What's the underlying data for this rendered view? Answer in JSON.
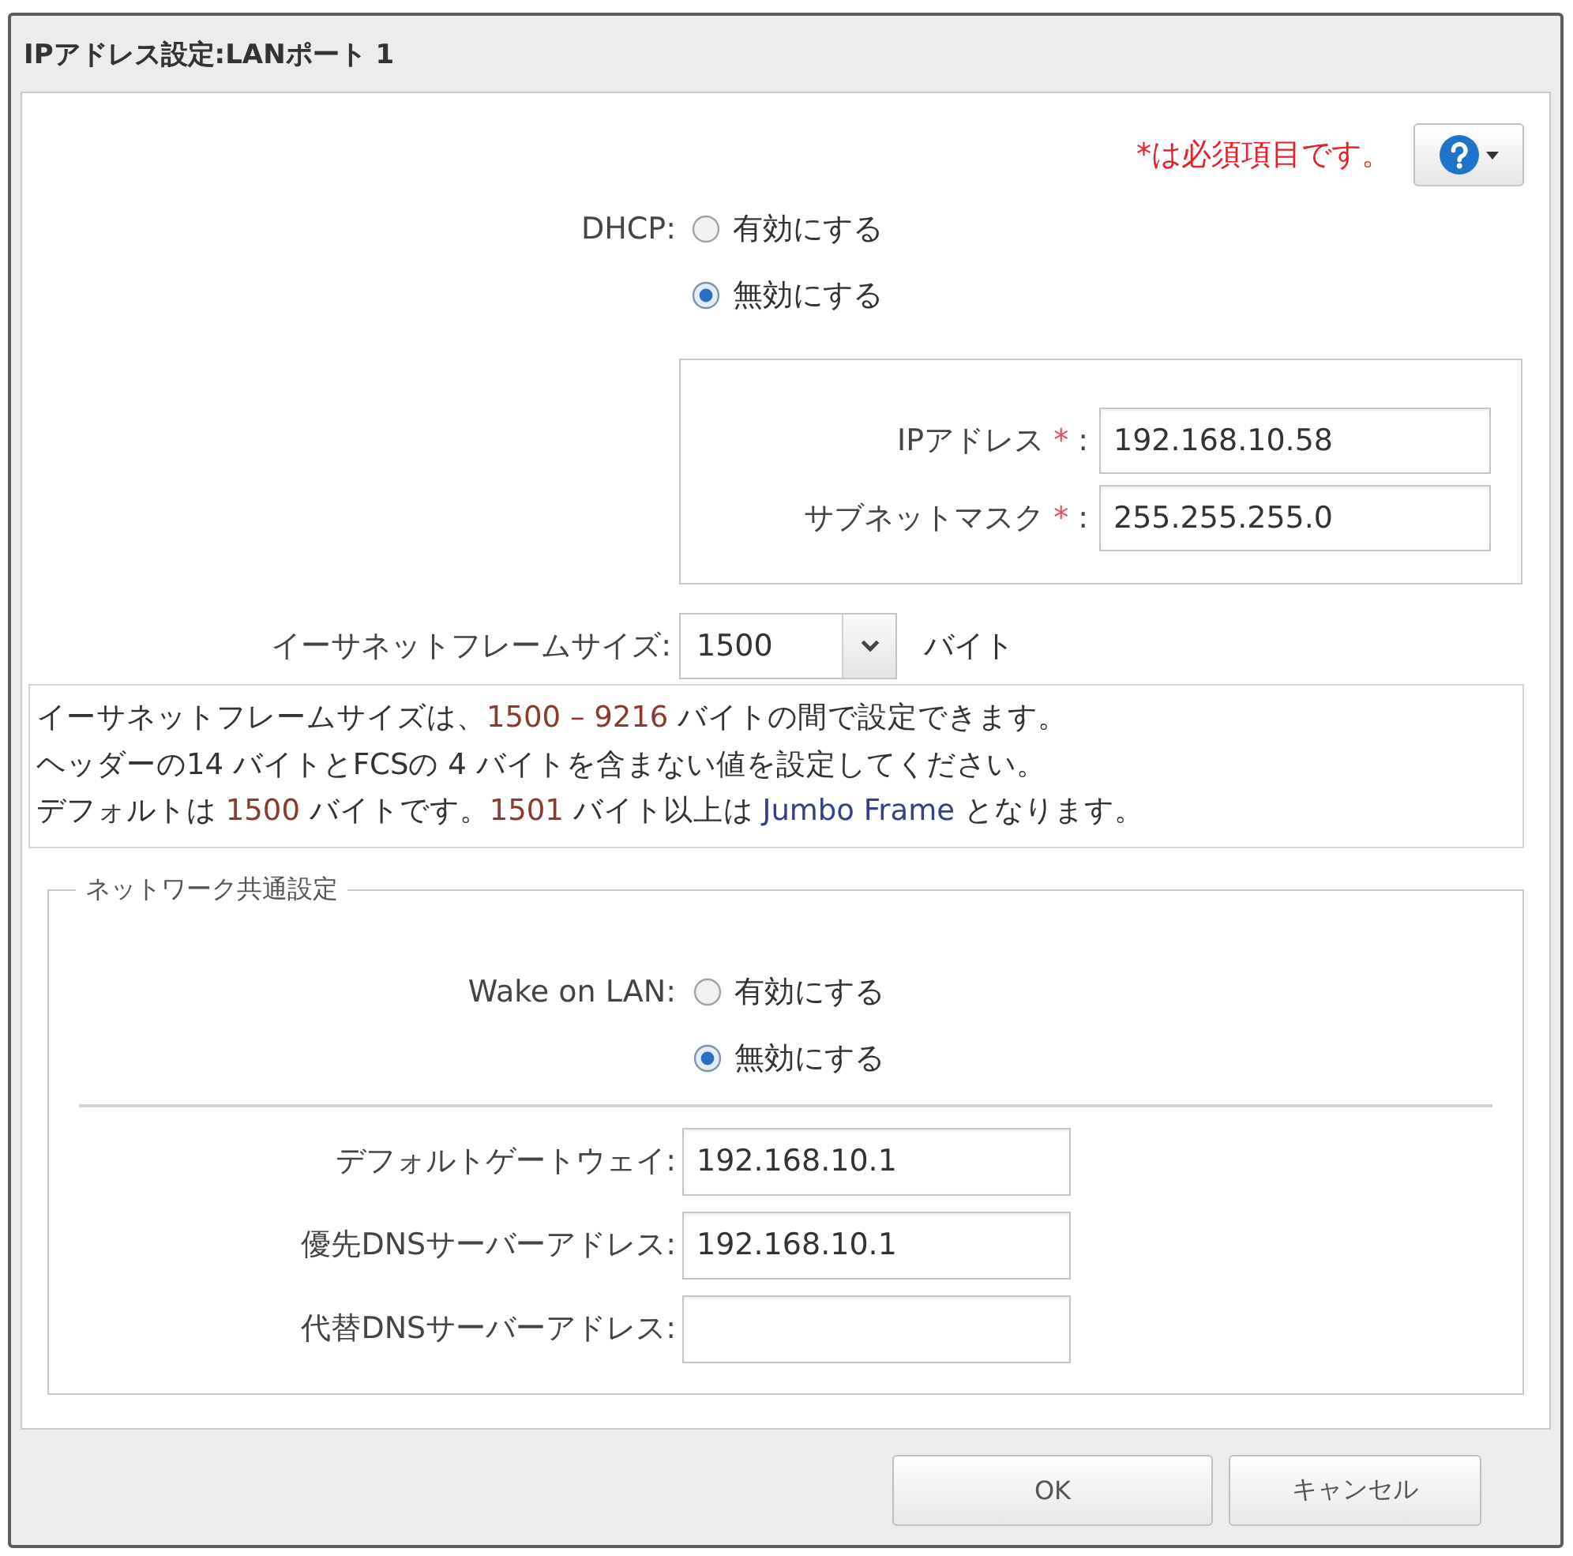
{
  "window": {
    "title": "IPアドレス設定:LANポート 1"
  },
  "required_note": "*は必須項目です。",
  "dhcp": {
    "label": "DHCP:",
    "options": [
      {
        "label": "有効にする",
        "selected": false
      },
      {
        "label": "無効にする",
        "selected": true
      }
    ]
  },
  "static_ip": {
    "fields": [
      {
        "label": "IPアドレス",
        "required_mark": "*",
        "label_suffix": ":",
        "value": "192.168.10.58"
      },
      {
        "label": "サブネットマスク",
        "required_mark": "*",
        "label_suffix": ":",
        "value": "255.255.255.0"
      }
    ]
  },
  "frame_size": {
    "label": "イーサネットフレームサイズ:",
    "value": "1500",
    "unit": "バイト"
  },
  "info": {
    "lines": [
      [
        {
          "text": "イーサネットフレームサイズは、",
          "kind": "plain"
        },
        {
          "text": "1500 – 9216",
          "kind": "number"
        },
        {
          "text": " バイトの間で設定できます。",
          "kind": "plain"
        }
      ],
      [
        {
          "text": "ヘッダーの14 バイトとFCSの 4 バイトを含まない値を設定してください。",
          "kind": "plain"
        }
      ],
      [
        {
          "text": "デフォルトは ",
          "kind": "plain"
        },
        {
          "text": "1500",
          "kind": "number"
        },
        {
          "text": " バイトです。",
          "kind": "plain"
        },
        {
          "text": "1501",
          "kind": "number"
        },
        {
          "text": " バイト以上は ",
          "kind": "plain"
        },
        {
          "text": "Jumbo Frame",
          "kind": "term"
        },
        {
          "text": " となります。",
          "kind": "plain"
        }
      ]
    ]
  },
  "network_common": {
    "legend": "ネットワーク共通設定",
    "wake_on_lan": {
      "label": "Wake on LAN:",
      "options": [
        {
          "label": "有効にする",
          "selected": false
        },
        {
          "label": "無効にする",
          "selected": true
        }
      ]
    },
    "fields": [
      {
        "label": "デフォルトゲートウェイ:",
        "value": "192.168.10.1"
      },
      {
        "label": "優先DNSサーバーアドレス:",
        "value": "192.168.10.1"
      },
      {
        "label": "代替DNSサーバーアドレス:"
      }
    ]
  },
  "buttons": [
    {
      "label": "OK"
    },
    {
      "label": "キャンセル"
    }
  ]
}
